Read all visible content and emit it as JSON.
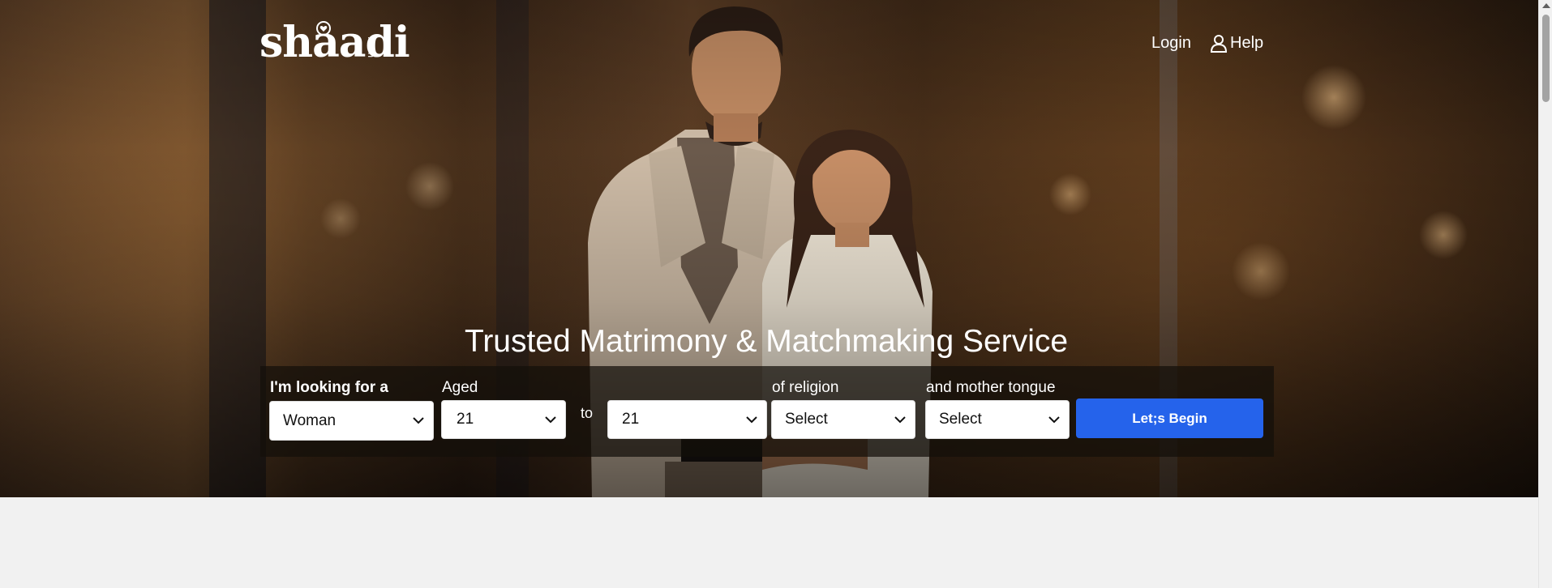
{
  "brand": {
    "logo_text": "shaadi",
    "logo_suffix": ".com"
  },
  "nav": {
    "login": "Login",
    "help": "Help"
  },
  "hero": {
    "title": "Trusted Matrimony & Matchmaking Service"
  },
  "search": {
    "looking_for_label": "I'm looking for a",
    "looking_for_value": "Woman",
    "aged_label": "Aged",
    "age_from_value": "21",
    "to_label": "to",
    "age_to_value": "21",
    "religion_label": "of religion",
    "religion_value": "Select",
    "tongue_label": "and mother tongue",
    "tongue_value": "Select",
    "submit_label": "Let;s Begin"
  },
  "colors": {
    "primary_button": "#2563eb",
    "page_background": "#f1f1f1"
  },
  "icons": {
    "help": "user-icon",
    "select": "chevron-down-icon"
  }
}
